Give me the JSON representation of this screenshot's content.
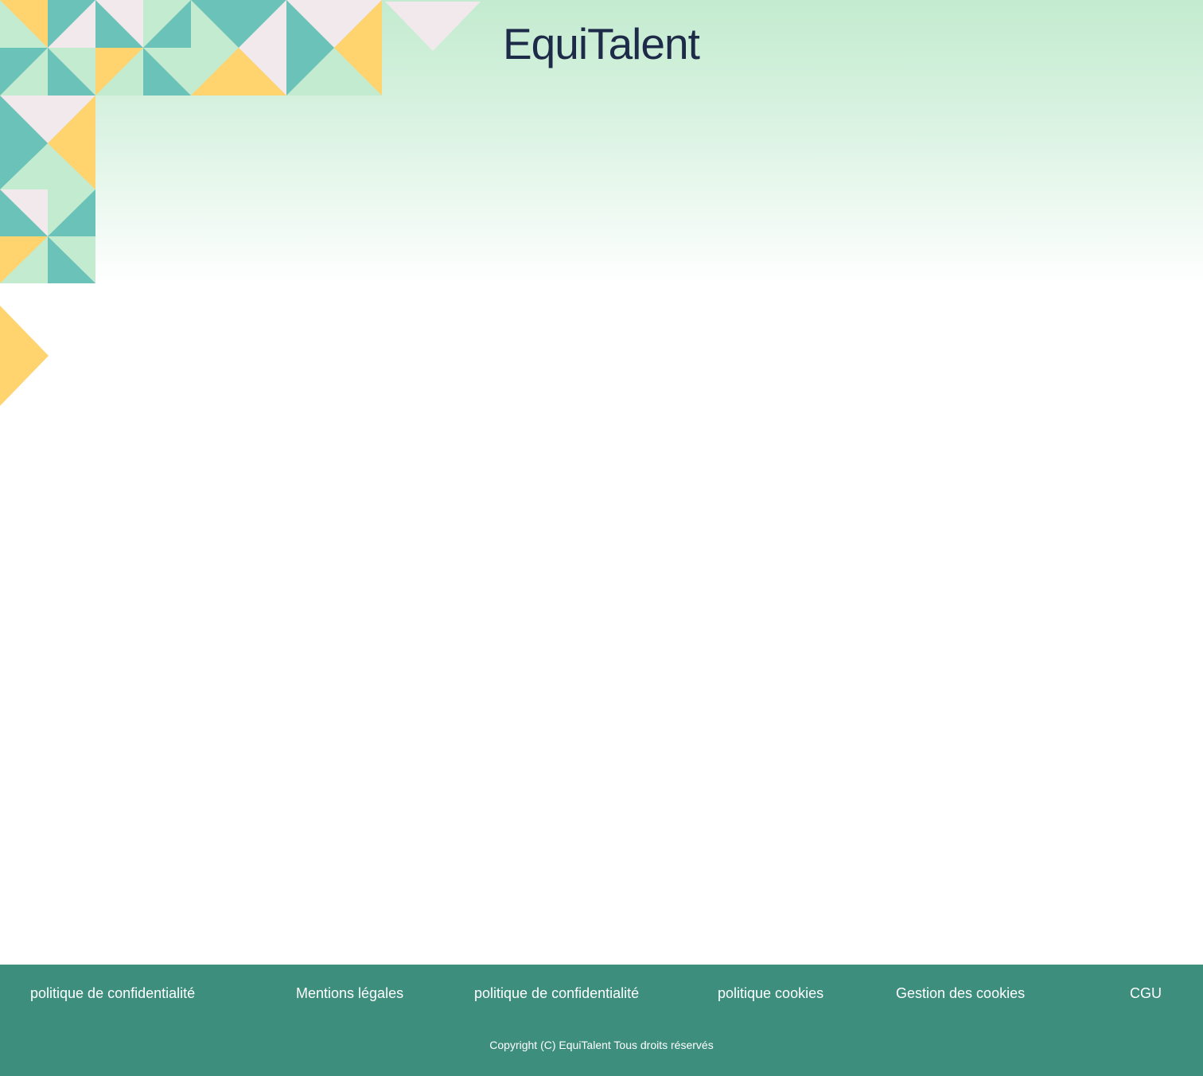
{
  "header": {
    "brand": "EquiTalent"
  },
  "colors": {
    "mint": "#c3ebcf",
    "teal": "#6bc2b8",
    "yellow": "#ffd36e",
    "blush": "#f1e9eb",
    "logo_text": "#1e2b48",
    "footer_bg": "#3e8e7e"
  },
  "footer": {
    "links": [
      {
        "label": "politique de confidentialité"
      },
      {
        "label": "Mentions légales"
      },
      {
        "label": "politique de confidentialité"
      },
      {
        "label": "politique cookies"
      },
      {
        "label": "Gestion des cookies"
      },
      {
        "label": "CGU"
      }
    ],
    "copyright": "Copyright (C) EquiTalent Tous droits réservés"
  }
}
